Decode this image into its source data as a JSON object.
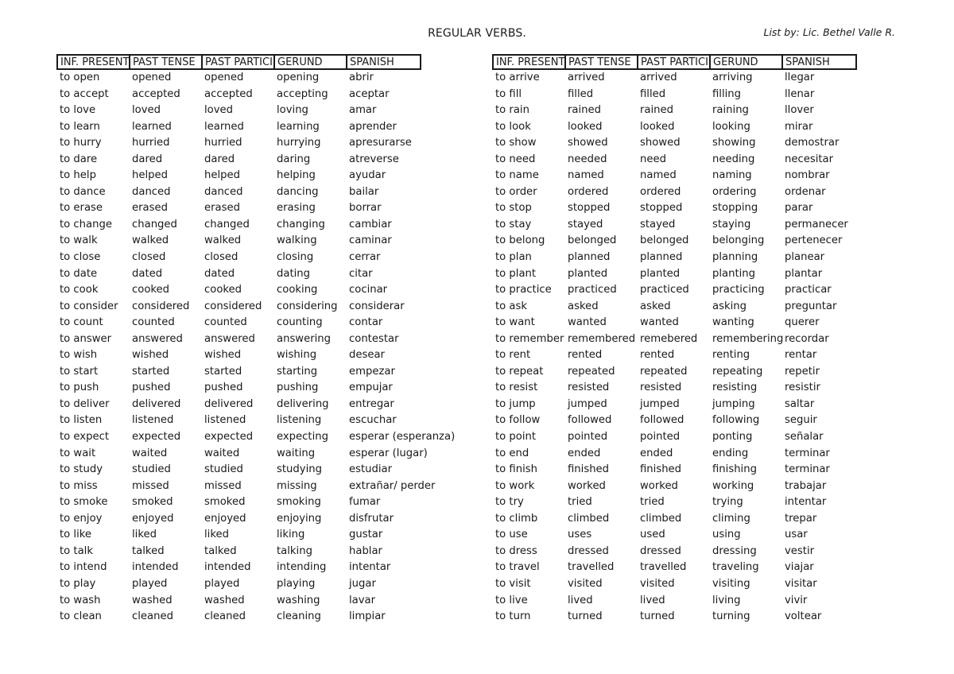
{
  "document": {
    "title": "REGULAR VERBS.",
    "author": "List by: Lic. Bethel Valle R."
  },
  "columns": [
    "INF. PRESENT",
    "PAST TENSE",
    "PAST PARTICIPLE",
    "GERUND",
    "SPANISH"
  ],
  "tables": [
    {
      "rows": [
        [
          "to open",
          "opened",
          "opened",
          "opening",
          "abrir"
        ],
        [
          "to accept",
          "accepted",
          "accepted",
          "accepting",
          "aceptar"
        ],
        [
          "to love",
          "loved",
          "loved",
          "loving",
          "amar"
        ],
        [
          "to learn",
          "learned",
          "learned",
          "learning",
          "aprender"
        ],
        [
          "to hurry",
          "hurried",
          "hurried",
          "hurrying",
          "apresurarse"
        ],
        [
          "to dare",
          "dared",
          "dared",
          "daring",
          "atreverse"
        ],
        [
          "to help",
          "helped",
          "helped",
          "helping",
          "ayudar"
        ],
        [
          "to dance",
          "danced",
          "danced",
          "dancing",
          "bailar"
        ],
        [
          "to erase",
          "erased",
          "erased",
          "erasing",
          "borrar"
        ],
        [
          "to change",
          "changed",
          "changed",
          "changing",
          "cambiar"
        ],
        [
          "to walk",
          "walked",
          "walked",
          "walking",
          "caminar"
        ],
        [
          "to close",
          "closed",
          "closed",
          "closing",
          "cerrar"
        ],
        [
          "to date",
          "dated",
          "dated",
          "dating",
          "citar"
        ],
        [
          "to cook",
          "cooked",
          "cooked",
          "cooking",
          "cocinar"
        ],
        [
          "to consider",
          "considered",
          "considered",
          "considering",
          "considerar"
        ],
        [
          "to count",
          "counted",
          "counted",
          "counting",
          "contar"
        ],
        [
          "to answer",
          "answered",
          "answered",
          "answering",
          "contestar"
        ],
        [
          "to wish",
          "wished",
          "wished",
          "wishing",
          "desear"
        ],
        [
          "to start",
          "started",
          "started",
          "starting",
          "empezar"
        ],
        [
          "to push",
          "pushed",
          "pushed",
          "pushing",
          "empujar"
        ],
        [
          "to deliver",
          "delivered",
          "delivered",
          "delivering",
          "entregar"
        ],
        [
          "to listen",
          "listened",
          "listened",
          "listening",
          "escuchar"
        ],
        [
          "to expect",
          "expected",
          "expected",
          "expecting",
          "esperar (esperanza)"
        ],
        [
          "to wait",
          "waited",
          "waited",
          "waiting",
          "esperar (lugar)"
        ],
        [
          "to study",
          "studied",
          "studied",
          "studying",
          "estudiar"
        ],
        [
          "to miss",
          "missed",
          "missed",
          "missing",
          "extrañar/ perder"
        ],
        [
          "to smoke",
          "smoked",
          "smoked",
          "smoking",
          "fumar"
        ],
        [
          "to enjoy",
          "enjoyed",
          "enjoyed",
          "enjoying",
          "disfrutar"
        ],
        [
          "to like",
          "liked",
          "liked",
          "liking",
          "gustar"
        ],
        [
          "to talk",
          "talked",
          "talked",
          "talking",
          "hablar"
        ],
        [
          "to intend",
          "intended",
          "intended",
          "intending",
          "intentar"
        ],
        [
          "to play",
          "played",
          "played",
          "playing",
          "jugar"
        ],
        [
          "to wash",
          "washed",
          "washed",
          "washing",
          "lavar"
        ],
        [
          "to clean",
          "cleaned",
          "cleaned",
          "cleaning",
          "limpiar"
        ]
      ]
    },
    {
      "rows": [
        [
          "to arrive",
          "arrived",
          "arrived",
          "arriving",
          "llegar"
        ],
        [
          "to fill",
          "filled",
          "filled",
          "filling",
          "llenar"
        ],
        [
          "to rain",
          "rained",
          "rained",
          "raining",
          "llover"
        ],
        [
          "to look",
          "looked",
          "looked",
          "looking",
          "mirar"
        ],
        [
          "to show",
          "showed",
          "showed",
          "showing",
          "demostrar"
        ],
        [
          "to need",
          "needed",
          "need",
          "needing",
          "necesitar"
        ],
        [
          "to name",
          "named",
          "named",
          "naming",
          "nombrar"
        ],
        [
          "to order",
          "ordered",
          "ordered",
          "ordering",
          "ordenar"
        ],
        [
          "to stop",
          "stopped",
          "stopped",
          "stopping",
          "parar"
        ],
        [
          "to stay",
          "stayed",
          "stayed",
          "staying",
          "permanecer"
        ],
        [
          "to belong",
          "belonged",
          "belonged",
          "belonging",
          "pertenecer"
        ],
        [
          "to plan",
          "planned",
          "planned",
          "planning",
          "planear"
        ],
        [
          "to plant",
          "planted",
          "planted",
          "planting",
          "plantar"
        ],
        [
          "to practice",
          "practiced",
          "practiced",
          "practicing",
          "practicar"
        ],
        [
          "to ask",
          "asked",
          "asked",
          "asking",
          "preguntar"
        ],
        [
          "to want",
          "wanted",
          "wanted",
          "wanting",
          "querer"
        ],
        [
          "to remember",
          "remembered",
          "remebered",
          "remembering",
          "recordar"
        ],
        [
          "to rent",
          "rented",
          "rented",
          "renting",
          "rentar"
        ],
        [
          "to repeat",
          "repeated",
          "repeated",
          "repeating",
          "repetir"
        ],
        [
          "to resist",
          "resisted",
          "resisted",
          "resisting",
          "resistir"
        ],
        [
          "to jump",
          "jumped",
          "jumped",
          "jumping",
          "saltar"
        ],
        [
          "to follow",
          "followed",
          "followed",
          "following",
          "seguir"
        ],
        [
          "to point",
          "pointed",
          "pointed",
          "ponting",
          "señalar"
        ],
        [
          "to end",
          "ended",
          "ended",
          "ending",
          "terminar"
        ],
        [
          "to finish",
          "finished",
          "finished",
          "finishing",
          "terminar"
        ],
        [
          "to work",
          "worked",
          "worked",
          "working",
          "trabajar"
        ],
        [
          "to try",
          "tried",
          "tried",
          "trying",
          "intentar"
        ],
        [
          "to climb",
          "climbed",
          "climbed",
          "climing",
          "trepar"
        ],
        [
          "to use",
          "uses",
          "used",
          "using",
          "usar"
        ],
        [
          "to dress",
          "dressed",
          "dressed",
          "dressing",
          "vestir"
        ],
        [
          "to travel",
          "travelled",
          "travelled",
          "traveling",
          "viajar"
        ],
        [
          "to visit",
          "visited",
          "visited",
          "visiting",
          "visitar"
        ],
        [
          "to live",
          "lived",
          "lived",
          "living",
          "vivir"
        ],
        [
          "to turn",
          "turned",
          "turned",
          "turning",
          "voltear"
        ]
      ]
    }
  ]
}
